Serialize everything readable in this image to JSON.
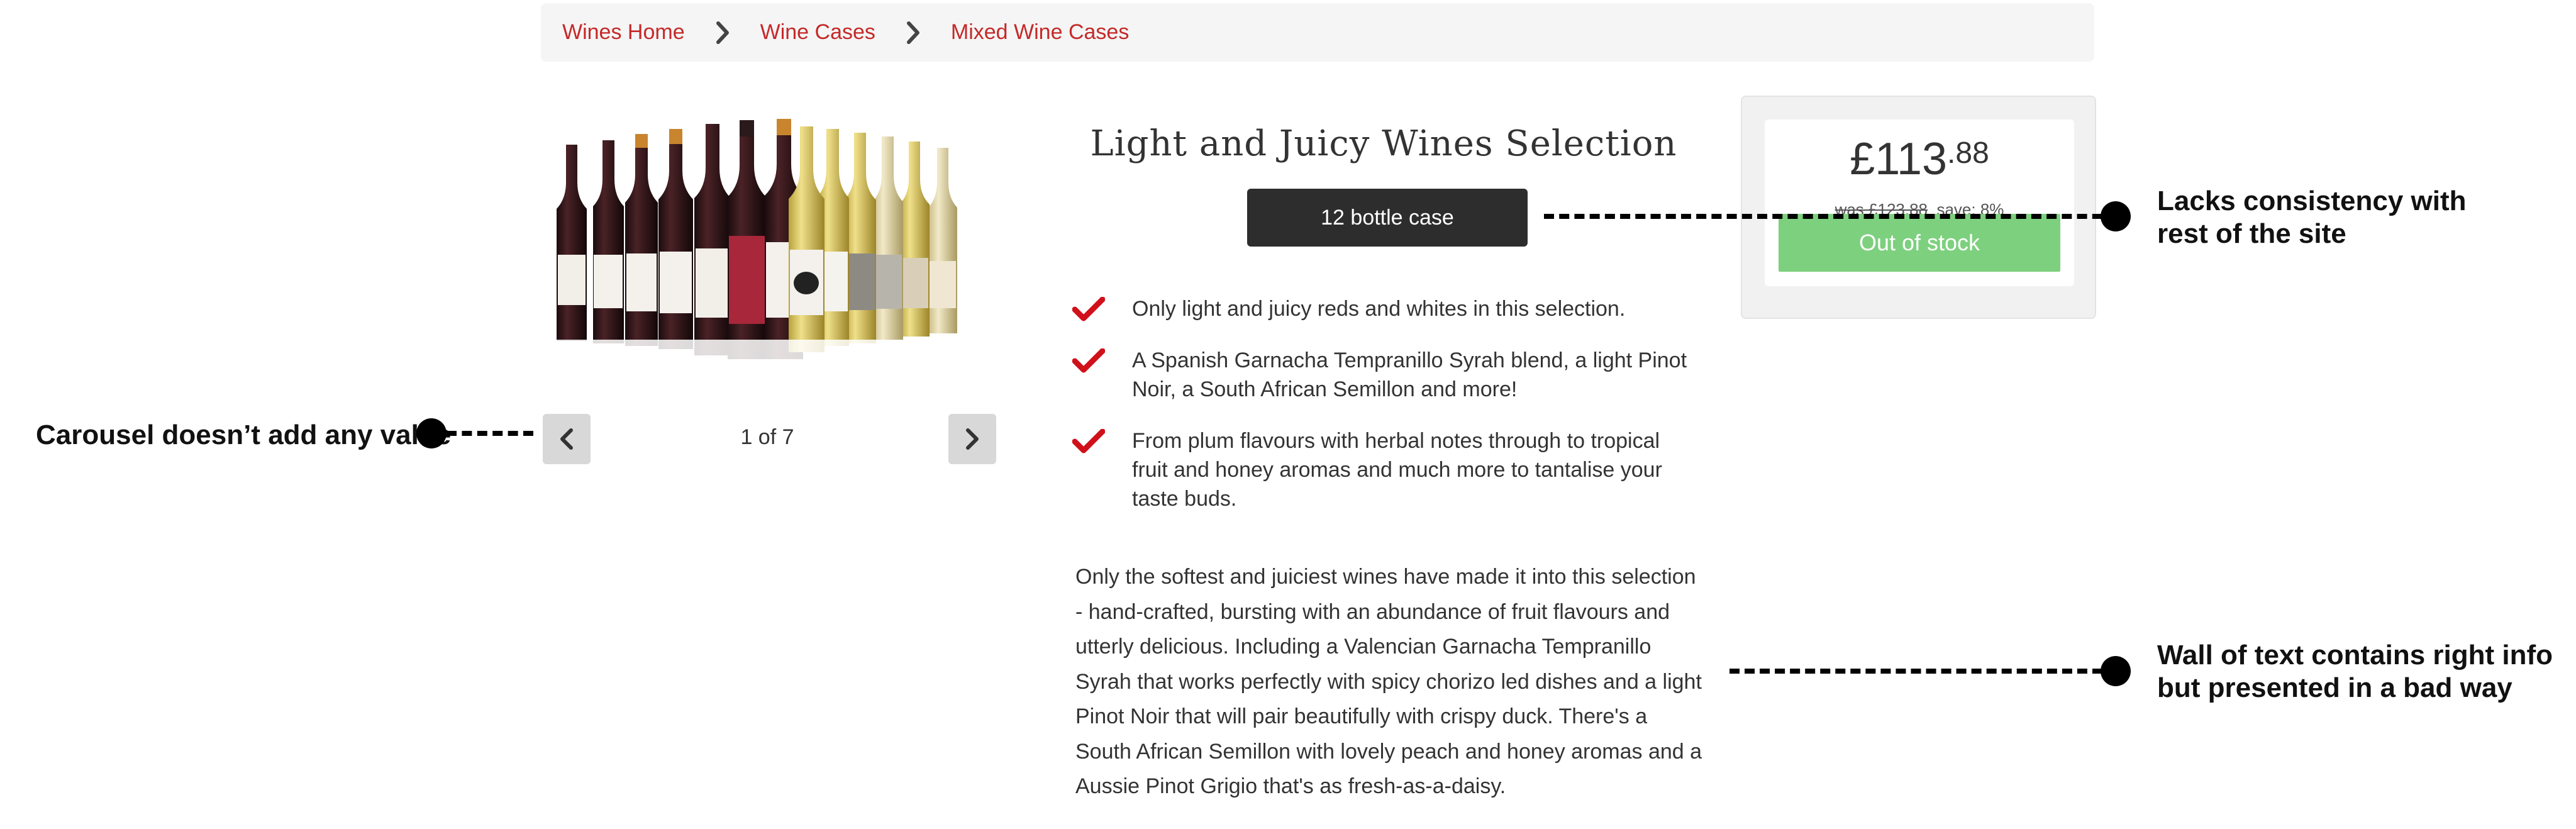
{
  "breadcrumb": {
    "items": [
      "Wines Home",
      "Wine Cases",
      "Mixed Wine Cases"
    ]
  },
  "carousel": {
    "counter": "1 of 7",
    "prev_icon": "chevron-left-icon",
    "next_icon": "chevron-right-icon"
  },
  "product": {
    "title": "Light and Juicy Wines Selection",
    "case_option": "12 bottle case",
    "features": [
      "Only light and juicy reds and whites in this selection.",
      "A Spanish Garnacha Tempranillo Syrah blend, a light Pinot Noir, a South African Semillon and more!",
      "From plum flavours with herbal notes through to tropical fruit and honey aromas and much more to tantalise your taste buds."
    ],
    "description": "Only the softest and juiciest wines have made it into this selection - hand-crafted, bursting with an abundance of fruit flavours and utterly delicious. Including a Valencian Garnacha Tempranillo Syrah that works perfectly with spicy chorizo led dishes and a light Pinot Noir that will pair beautifully with crispy duck. There's a South African Semillon with lovely peach and honey aromas and a Aussie Pinot Grigio that's as fresh-as-a-daisy."
  },
  "price": {
    "currency": "£",
    "whole": "113",
    "fraction": ".88",
    "was": "was £123.88",
    "save": "save: 8%",
    "stock_button": "Out of stock"
  },
  "annotations": {
    "carousel": "Carousel doesn’t add any value",
    "consistency_line1": "Lacks consistency with",
    "consistency_line2": "rest of the site",
    "wall_line1": "Wall of text contains right info",
    "wall_line2": "but presented in a bad way"
  },
  "colors": {
    "accent_red": "#c62828",
    "case_button_bg": "#2d2d2d",
    "stock_button_bg": "#7dd07e"
  }
}
